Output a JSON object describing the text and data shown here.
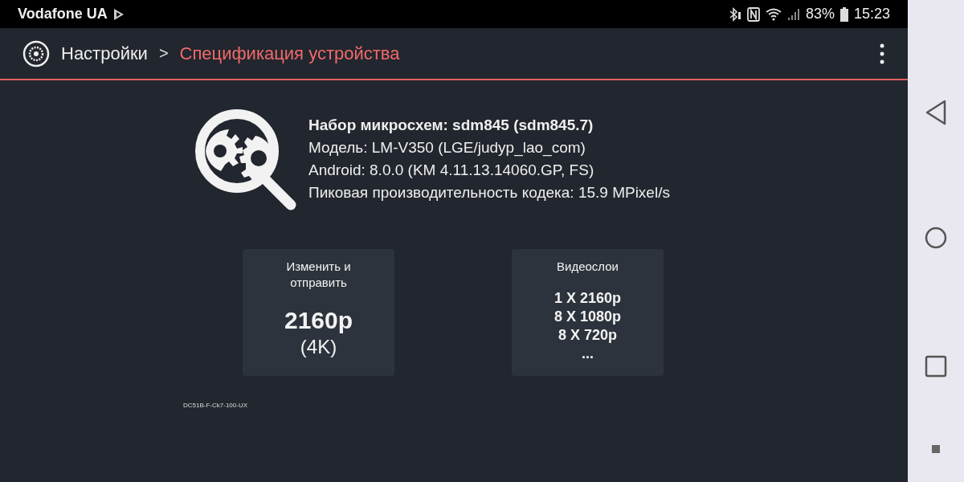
{
  "status_bar": {
    "carrier": "Vodafone UA",
    "battery": "83%",
    "time": "15:23"
  },
  "toolbar": {
    "breadcrumb": [
      {
        "label": "Настройки",
        "selected": false
      },
      {
        "label": "Спецификация устройства",
        "selected": true
      }
    ],
    "separator": ">"
  },
  "info_lines": [
    {
      "text": "Набор микросхем: sdm845 (sdm845.7)",
      "emphasized": true
    },
    {
      "text": "Модель: LM-V350 (LGE/judyp_lao_com)",
      "emphasized": false
    },
    {
      "text": "Android: 8.0.0 (KM 4.11.13.14060.GP, FS)",
      "emphasized": false
    },
    {
      "text": "Пиковая производительность кодека: 15.9 MPixel/s",
      "emphasized": false
    }
  ],
  "cards": [
    {
      "kind": "value",
      "title": "Изменить и отправить",
      "value": "2160p",
      "subvalue": "(4K)"
    },
    {
      "kind": "list",
      "title": "Видеослои",
      "lines": [
        "1 X 2160p",
        "8 X 1080p",
        "8 X 720p",
        "..."
      ]
    }
  ],
  "footnote": "DC51B-F-Ck7-100-UX"
}
